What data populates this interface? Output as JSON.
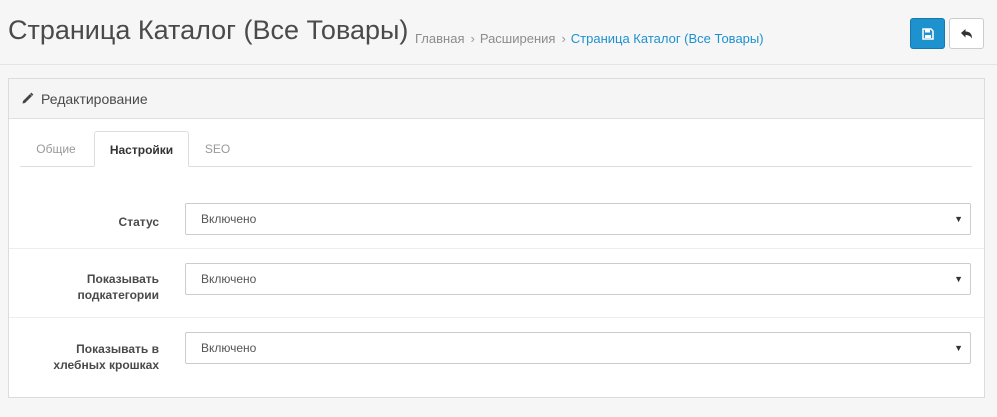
{
  "header": {
    "title": "Страница Каталог (Все Товары)",
    "breadcrumbs": [
      {
        "label": "Главная",
        "active": false
      },
      {
        "label": "Расширения",
        "active": false
      },
      {
        "label": "Страница Каталог (Все Товары)",
        "active": true
      }
    ],
    "separator": "›",
    "buttons": {
      "save_icon": "save-icon",
      "back_icon": "reply-icon"
    }
  },
  "panel": {
    "heading": "Редактирование",
    "heading_icon": "pencil-icon",
    "tabs": [
      {
        "label": "Общие",
        "active": false
      },
      {
        "label": "Настройки",
        "active": true
      },
      {
        "label": "SEO",
        "active": false
      }
    ],
    "fields": [
      {
        "label": "Статус",
        "value": "Включено"
      },
      {
        "label": "Показывать подкатегории",
        "value": "Включено"
      },
      {
        "label": "Показывать в хлебных крошках",
        "value": "Включено"
      }
    ],
    "caret": "▼"
  },
  "colors": {
    "primary": "#1e91cf",
    "background": "#f6f6f6"
  }
}
